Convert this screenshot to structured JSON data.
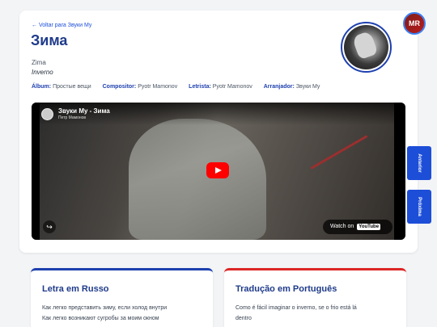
{
  "nav": {
    "back_label": "← Voltar para Звуки Му"
  },
  "song": {
    "title": "Зима",
    "transliteration": "Zima",
    "translation": "Inverno"
  },
  "meta": {
    "album_label": "Álbum:",
    "album": "Простые вещи",
    "composer_label": "Compositor:",
    "composer": "Pyotr Mamonov",
    "lyricist_label": "Letrista:",
    "lyricist": "Pyotr Mamonov",
    "arranger_label": "Arranjador:",
    "arranger": "Звуки Му"
  },
  "video": {
    "title": "Звуки Му - Зима",
    "channel": "Петр Мамонов",
    "watch_on": "Watch on",
    "youtube": "YouTube"
  },
  "badge": {
    "text": "MR"
  },
  "side_nav": {
    "previous": "Anterior",
    "next": "Próxima"
  },
  "lyrics_ru": {
    "heading": "Letra em Russo",
    "lines": [
      "Как легко представить зиму, если холод внутри",
      "Как легко возникают сугробы за моим окном"
    ]
  },
  "lyrics_pt": {
    "heading": "Tradução em Português",
    "lines": [
      "Como é fácil imaginar o inverno, se o frio está lá",
      "dentro"
    ]
  },
  "colors": {
    "accent": "#1e40af",
    "accent_dark": "#1e3a8a",
    "translation_accent": "#dc2626",
    "side_button": "#1d4ed8"
  },
  "icons": {
    "share": "share-icon",
    "play": "play-icon",
    "youtube": "youtube-logo-icon"
  }
}
